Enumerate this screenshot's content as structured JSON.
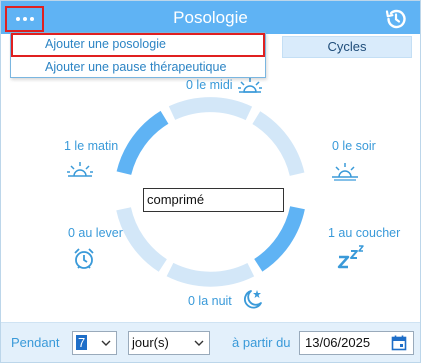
{
  "header": {
    "title": "Posologie",
    "menu_icon": "more-dots-icon",
    "history_icon": "history-icon"
  },
  "tabs": {
    "cycles_label": "Cycles"
  },
  "menu": {
    "items": [
      {
        "label": "Ajouter une posologie"
      },
      {
        "label": "Ajouter une pause thérapeutique"
      }
    ]
  },
  "slots": {
    "midi": {
      "label": "0 le midi",
      "icon": "sun-icon"
    },
    "matin": {
      "label": "1 le matin",
      "icon": "sunrise-icon"
    },
    "soir": {
      "label": "0 le soir",
      "icon": "sunset-icon"
    },
    "lever": {
      "label": "0 au lever",
      "icon": "alarm-clock-icon"
    },
    "coucher": {
      "label": "1 au coucher",
      "icon": "sleep-zzz-icon"
    },
    "nuit": {
      "label": "0 la nuit",
      "icon": "moon-star-icon"
    }
  },
  "unit": {
    "value": "comprimé"
  },
  "footer": {
    "pendant_label": "Pendant",
    "count_value": "7",
    "period_value": "jour(s)",
    "from_label": "à partir du",
    "date_value": "13/06/2025"
  },
  "colors": {
    "header": "#5fb3f4",
    "accent": "#3a9ad9",
    "ring_active": "#5fb3f4",
    "ring_inactive": "#d3e7f8",
    "highlight": "#e02020"
  }
}
